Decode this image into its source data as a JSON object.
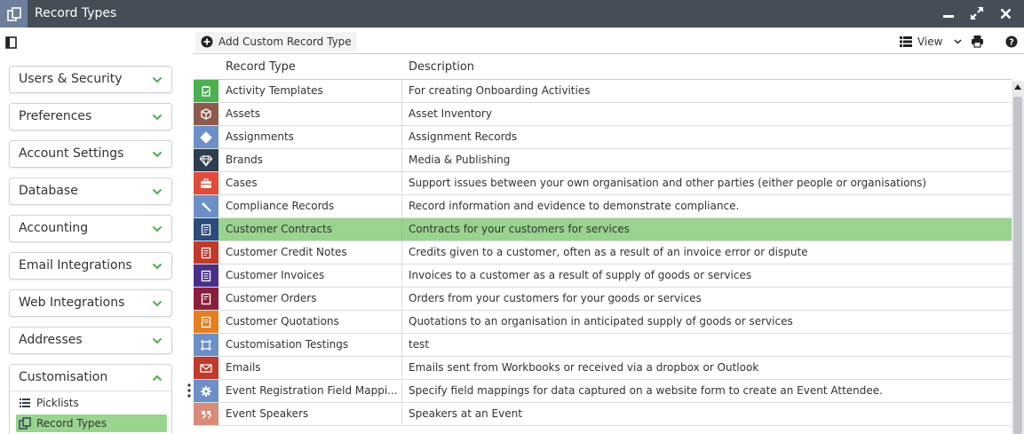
{
  "window": {
    "title": "Record Types"
  },
  "sidebar": {
    "sections": [
      {
        "label": "Users & Security"
      },
      {
        "label": "Preferences"
      },
      {
        "label": "Account Settings"
      },
      {
        "label": "Database"
      },
      {
        "label": "Accounting"
      },
      {
        "label": "Email Integrations"
      },
      {
        "label": "Web Integrations"
      },
      {
        "label": "Addresses"
      }
    ],
    "customisation": {
      "label": "Customisation",
      "items": [
        {
          "label": "Picklists",
          "icon": "list-icon",
          "active": false
        },
        {
          "label": "Record Types",
          "icon": "record-types-icon",
          "active": true
        }
      ]
    }
  },
  "toolbar": {
    "add_label": "Add Custom Record Type",
    "view_label": "View"
  },
  "table": {
    "columns": [
      "Record Type",
      "Description"
    ],
    "rows": [
      {
        "name": "Activity Templates",
        "description": "For creating Onboarding Activities",
        "icon": "clipboard-check-icon",
        "color": "#4caf50"
      },
      {
        "name": "Assets",
        "description": "Asset Inventory",
        "icon": "cube-icon",
        "color": "#8d5a4b"
      },
      {
        "name": "Assignments",
        "description": "Assignment Records",
        "icon": "certificate-icon",
        "color": "#6d8fc7"
      },
      {
        "name": "Brands",
        "description": "Media & Publishing",
        "icon": "diamond-icon",
        "color": "#2f3e4e"
      },
      {
        "name": "Cases",
        "description": "Support issues between your own organisation and other parties (either people or organisations)",
        "icon": "briefcase-icon",
        "color": "#e04b3a"
      },
      {
        "name": "Compliance Records",
        "description": "Record information and evidence to demonstrate compliance.",
        "icon": "gavel-icon",
        "color": "#6d8fc7"
      },
      {
        "name": "Customer Contracts",
        "description": "Contracts for your customers for services",
        "icon": "contract-icon",
        "color": "#2c4a7a",
        "selected": true
      },
      {
        "name": "Customer Credit Notes",
        "description": "Credits given to a customer, often as a result of an invoice error or dispute",
        "icon": "credit-note-icon",
        "color": "#c0392b"
      },
      {
        "name": "Customer Invoices",
        "description": "Invoices to a customer as a result of supply of goods or services",
        "icon": "invoice-icon",
        "color": "#4a2f8a"
      },
      {
        "name": "Customer Orders",
        "description": "Orders from your customers for your goods or services",
        "icon": "order-icon",
        "color": "#8a1f3d"
      },
      {
        "name": "Customer Quotations",
        "description": "Quotations to an organisation in anticipated supply of goods or services",
        "icon": "quotation-icon",
        "color": "#e67e22"
      },
      {
        "name": "Customisation Testings",
        "description": "test",
        "icon": "frame-icon",
        "color": "#6d8fc7"
      },
      {
        "name": "Emails",
        "description": "Emails sent from Workbooks or received via a dropbox or Outlook",
        "icon": "envelope-icon",
        "color": "#c0392b"
      },
      {
        "name": "Event Registration Field Mappi...",
        "description": "Specify field mappings for data captured on a website form to create an Event Attendee.",
        "icon": "gear-icon",
        "color": "#6d8fc7"
      },
      {
        "name": "Event Speakers",
        "description": "Speakers at an Event",
        "icon": "quote-icon",
        "color": "#d98b7a"
      }
    ]
  }
}
